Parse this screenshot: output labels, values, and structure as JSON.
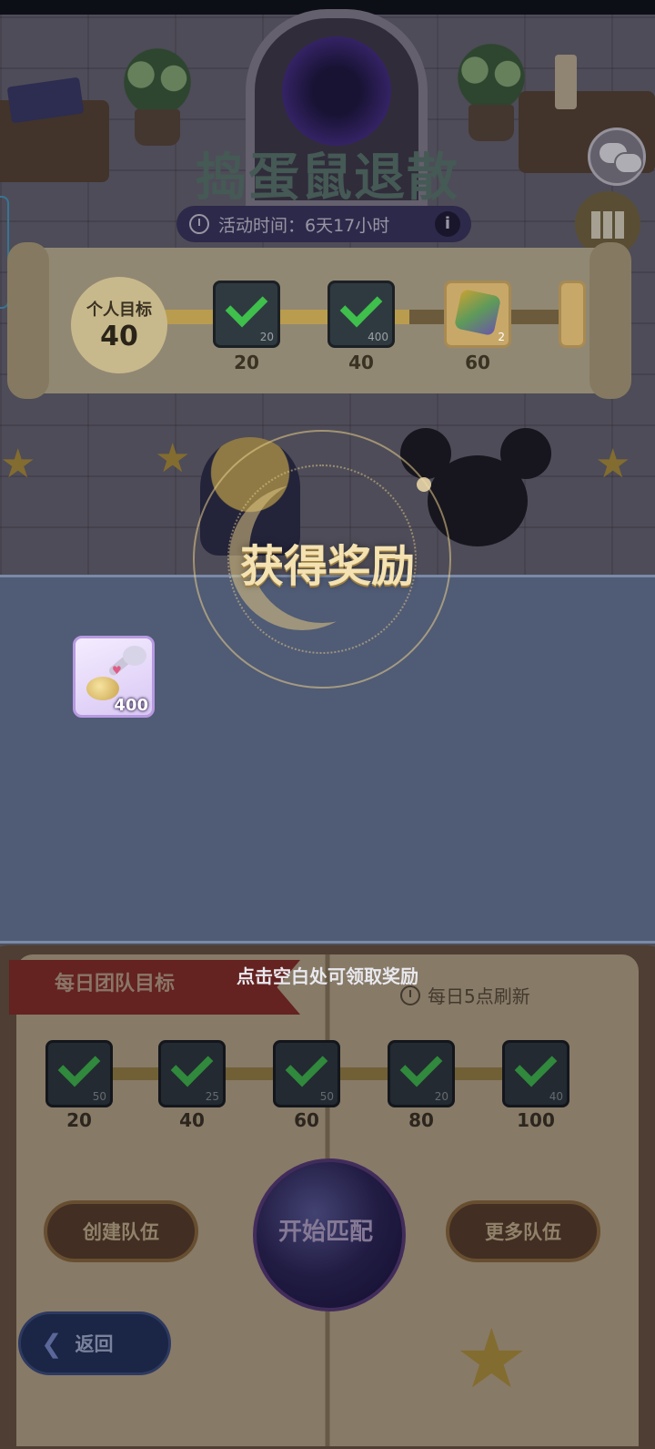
{
  "event": {
    "title": "捣蛋鼠退散",
    "timer": "活动时间：6天17小时",
    "info_glyph": "i"
  },
  "personal_goal": {
    "label": "个人目标",
    "value": "40",
    "rewards": [
      {
        "threshold": "20",
        "count": "20",
        "claimed": true
      },
      {
        "threshold": "40",
        "count": "400",
        "claimed": true
      },
      {
        "threshold": "60",
        "count": "2",
        "claimed": false,
        "icon": "crystal-icon"
      }
    ]
  },
  "reward_popup": {
    "title": "获得奖励",
    "item_quantity": "400",
    "item_icon": "cat-spoon-icon",
    "hint": "点击空白处可领取奖励"
  },
  "team_goal": {
    "title": "每日团队目标",
    "refresh": "每日5点刷新",
    "rewards": [
      {
        "threshold": "20",
        "count": "50",
        "claimed": true
      },
      {
        "threshold": "40",
        "count": "25",
        "claimed": true
      },
      {
        "threshold": "60",
        "count": "50",
        "claimed": true
      },
      {
        "threshold": "80",
        "count": "20",
        "claimed": true
      },
      {
        "threshold": "100",
        "count": "40",
        "claimed": true
      }
    ]
  },
  "actions": {
    "create_team": "创建队伍",
    "start_match": "开始匹配",
    "more_teams": "更多队伍",
    "back": "返回"
  },
  "colors": {
    "reward_band": "#505b75",
    "reward_title": "#f4e2b2",
    "check_green": "#3fbf4c"
  }
}
